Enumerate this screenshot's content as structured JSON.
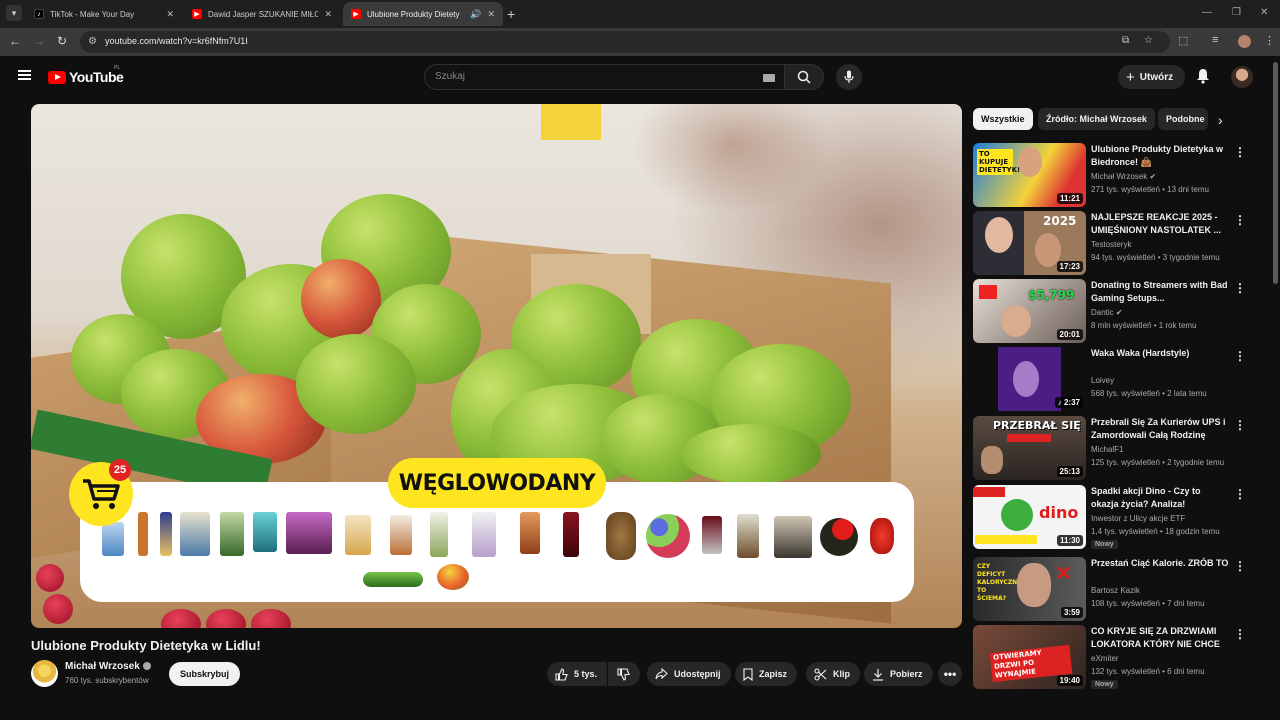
{
  "browser": {
    "tabs": [
      {
        "title": "TikTok - Make Your Day",
        "favicon": "tiktok-icon",
        "active": false
      },
      {
        "title": "Dawid Jasper SZUKANIE MIŁOŚ",
        "favicon": "youtube-icon",
        "active": false
      },
      {
        "title": "Ulubione Produkty Dietety",
        "favicon": "youtube-icon",
        "active": true
      }
    ],
    "url": "youtube.com/watch?v=kr6fNfm7U1I"
  },
  "header": {
    "logo_text": "YouTube",
    "country_code": "PL",
    "search_placeholder": "Szukaj",
    "create_label": "Utwórz"
  },
  "video": {
    "title": "Ulubione Produkty Dietetyka w Lidlu!",
    "overlay_label": "WĘGLOWODANY",
    "cart_count": "25",
    "channel": {
      "name": "Michał Wrzosek",
      "subscribers": "760 tys. subskrybentów",
      "subscribe_label": "Subskrybuj"
    },
    "actions": {
      "likes": "5 tys.",
      "share": "Udostępnij",
      "save": "Zapisz",
      "clip": "Klip",
      "download": "Pobierz"
    }
  },
  "sidebar": {
    "chips": [
      "Wszystkie",
      "Źródło: Michał Wrzosek",
      "Podobne"
    ],
    "items": [
      {
        "title": "Ulubione Produkty Dietetyka w Biedronce! 👜",
        "channel": "Michał Wrzosek",
        "verified": true,
        "meta": "271 tys. wyświetleń • 13 dni temu",
        "duration": "11:21",
        "thumb_text": "TO KUPUJE DIETETYK!"
      },
      {
        "title": "NAJLEPSZE REAKCJE 2025 - UMIĘŚNIONY NASTOLATEK ...",
        "channel": "Testosteryk",
        "verified": false,
        "meta": "94 tys. wyświetleń • 3 tygodnie temu",
        "duration": "17:23",
        "thumb_text": "2025"
      },
      {
        "title": "Donating to Streamers with Bad Gaming Setups...",
        "channel": "Dantic",
        "verified": true,
        "meta": "8 mln wyświetleń • 1 rok temu",
        "duration": "20:01",
        "thumb_text": "$5,799"
      },
      {
        "title": "Waka Waka (Hardstyle)",
        "channel": "Loivey",
        "verified": false,
        "meta": "568 tys. wyświetleń • 2 lata temu",
        "duration": "2:37",
        "thumb_text": ""
      },
      {
        "title": "Przebrali Się Za Kurierów UPS i Zamordowali Całą Rodzinę",
        "channel": "MichalF1",
        "verified": false,
        "meta": "125 tys. wyświetleń • 2 tygodnie temu",
        "duration": "25:13",
        "thumb_text": "PRZEBRAŁ SIĘ"
      },
      {
        "title": "Spadki akcji Dino - Czy to okazja życia? Analiza!",
        "channel": "Inwestor z Ulicy akcje ETF",
        "verified": false,
        "meta": "1,4 tys. wyświetleń • 18 godzin temu",
        "duration": "11:30",
        "badge": "Nowy",
        "thumb_text": "dino"
      },
      {
        "title": "Przestań Ciąć Kalorie. ZRÓB TO",
        "channel": "Bartosz Kazik",
        "verified": false,
        "meta": "108 tys. wyświetleń • 7 dni temu",
        "duration": "3:59",
        "thumb_text": "CZY DEFICYT KALORYCZNY TO ŚCIEMA?"
      },
      {
        "title": "CO KRYJE SIĘ ZA DRZWIAMI LOKATORA KTÓRY NIE CHCE ...",
        "channel": "eXmiter",
        "verified": false,
        "meta": "132 tys. wyświetleń • 6 dni temu",
        "duration": "19:40",
        "badge": "Nowy",
        "thumb_text": "OTWIERAMY DRZWI PO WYNAJMIE"
      }
    ]
  },
  "colors": {
    "accent": "#ff0000",
    "overlay_yellow": "#ffe51f",
    "bg": "#0f0f0f"
  }
}
